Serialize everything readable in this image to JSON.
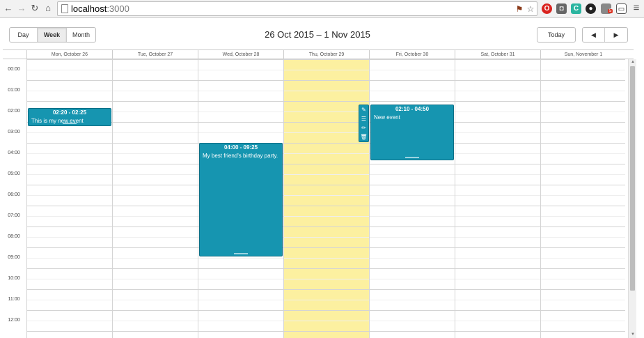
{
  "browser": {
    "url_host": "localhost",
    "url_port": ":3000",
    "back_icon": "←",
    "forward_icon": "→",
    "reload_icon": "↻",
    "home_icon": "⌂",
    "menu_icon": "≡",
    "star_icon": "☆",
    "badge_count": "5",
    "ext_c_label": "C"
  },
  "toolbar": {
    "view_day": "Day",
    "view_week": "Week",
    "view_month": "Month",
    "active_view": "Week",
    "range_title": "26 Oct 2015 – 1 Nov 2015",
    "today_label": "Today",
    "prev_icon": "◀",
    "next_icon": "▶"
  },
  "calendar": {
    "days": [
      {
        "label": "Mon, October 26"
      },
      {
        "label": "Tue, October 27"
      },
      {
        "label": "Wed, October 28"
      },
      {
        "label": "Thu, October 29"
      },
      {
        "label": "Fri, October 30"
      },
      {
        "label": "Sat, October 31"
      },
      {
        "label": "Sun, November 1"
      }
    ],
    "today_index": 3,
    "hours": [
      "00:00",
      "01:00",
      "02:00",
      "03:00",
      "04:00",
      "05:00",
      "06:00",
      "07:00",
      "08:00",
      "09:00",
      "10:00",
      "11:00",
      "12:00"
    ],
    "events": [
      {
        "day": 0,
        "start": "02:20",
        "end": "02:25",
        "time_label": "02:20 - 02:25",
        "title": "This is my new event"
      },
      {
        "day": 2,
        "start": "04:00",
        "end": "09:25",
        "time_label": "04:00 - 09:25",
        "title": "My best friend's birthday party."
      },
      {
        "day": 4,
        "start": "02:10",
        "end": "04:50",
        "time_label": "02:10 - 04:50",
        "title": "New event"
      }
    ],
    "event_tools": [
      "✎",
      "☰",
      "✏",
      "🗑"
    ],
    "colors": {
      "event": "#1695b0",
      "today": "#fcf0a0"
    }
  }
}
